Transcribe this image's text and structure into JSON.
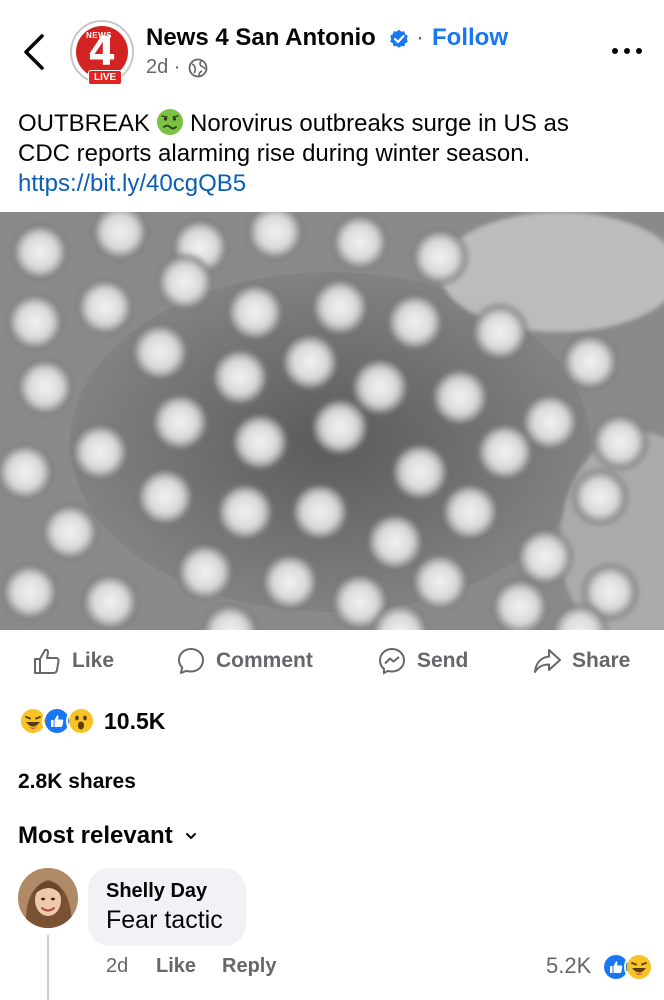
{
  "header": {
    "page_name": "News 4 San Antonio",
    "follow_label": "Follow",
    "separator": "·",
    "time": "2d ·",
    "logo_number": "4",
    "logo_word": "NEWS",
    "live_badge": "LIVE"
  },
  "post": {
    "text_part1": "OUTBREAK",
    "text_part2": "Norovirus outbreaks surge in US as",
    "text_line2": "CDC reports alarming rise during winter season.",
    "link": "https://bit.ly/40cgQB5"
  },
  "actions": {
    "like": "Like",
    "comment": "Comment",
    "send": "Send",
    "share": "Share"
  },
  "reactions": {
    "count": "10.5K",
    "icons": [
      "haha-icon",
      "like-icon",
      "wow-icon"
    ]
  },
  "shares": "2.8K shares",
  "sort_label": "Most relevant",
  "comment": {
    "author": "Shelly Day",
    "text": "Fear tactic",
    "time": "2d",
    "like": "Like",
    "reply": "Reply",
    "reaction_count": "5.2K"
  },
  "colors": {
    "accent": "#1877f2",
    "link": "#0a5fb4",
    "secondary_text": "#65676b",
    "brand_red": "#d32323"
  }
}
